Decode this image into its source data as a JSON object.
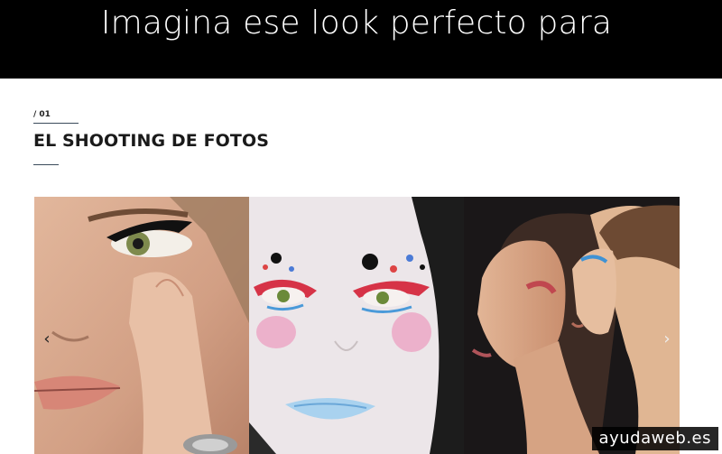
{
  "hero": {
    "title": "Imagina ese look perfecto para"
  },
  "section": {
    "number": "/ 01",
    "title": "EL SHOOTING DE FOTOS"
  },
  "gallery": {
    "prev_icon": "chevron-left-icon",
    "next_icon": "chevron-right-icon",
    "slides": [
      {
        "name": "slide-eyeliner"
      },
      {
        "name": "slide-clown-makeup"
      },
      {
        "name": "slide-profile-models"
      }
    ]
  },
  "watermark": {
    "text": "ayudaweb.es"
  }
}
